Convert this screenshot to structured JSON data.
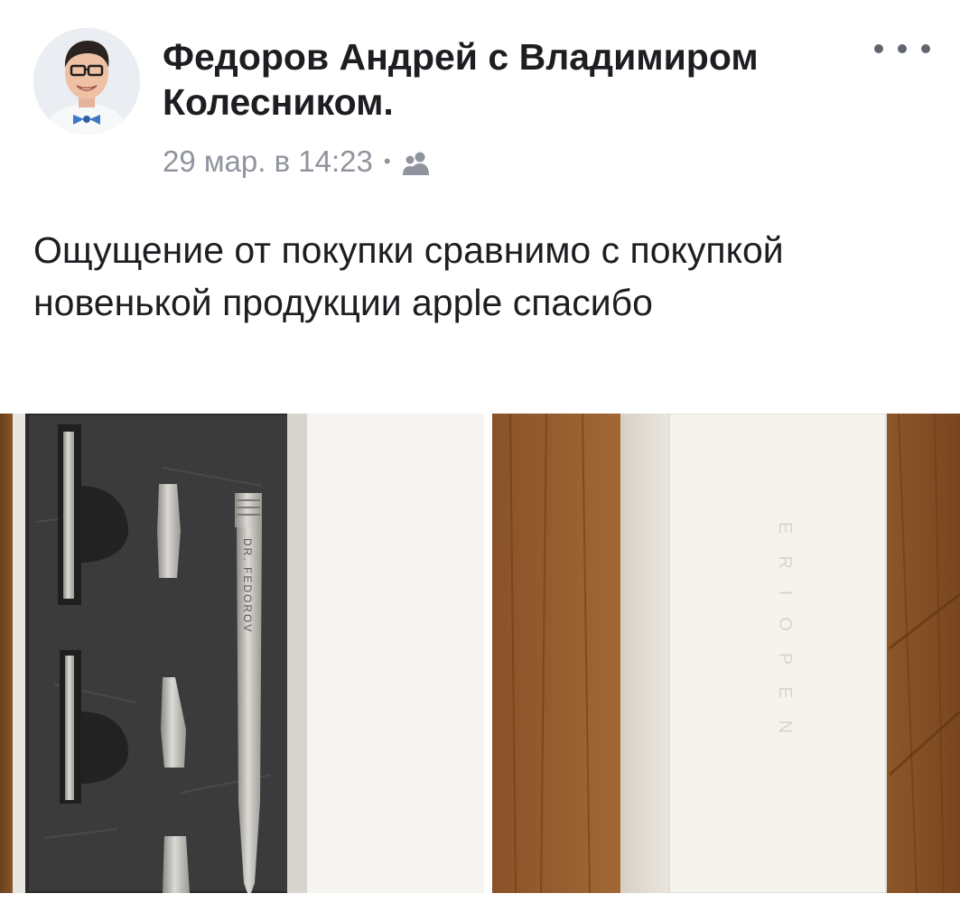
{
  "post": {
    "author_line": "Федоров Андрей с Владимиром Колесником.",
    "date": "29 мар. в 14:23",
    "separator": "•",
    "audience_icon": "friends-icon",
    "menu_icon": "more-options-icon",
    "text": "Ощущение от покупки сравнимо с покупкой новенькой продукции  apple спасибо"
  },
  "photos": [
    {
      "name": "photo-pen-case",
      "engraving": "DR. FEDOROV"
    },
    {
      "name": "photo-white-box",
      "embossing": "ERIOPEN"
    }
  ],
  "colors": {
    "text": "#1c1e21",
    "meta": "#90949c",
    "background": "#ffffff"
  }
}
